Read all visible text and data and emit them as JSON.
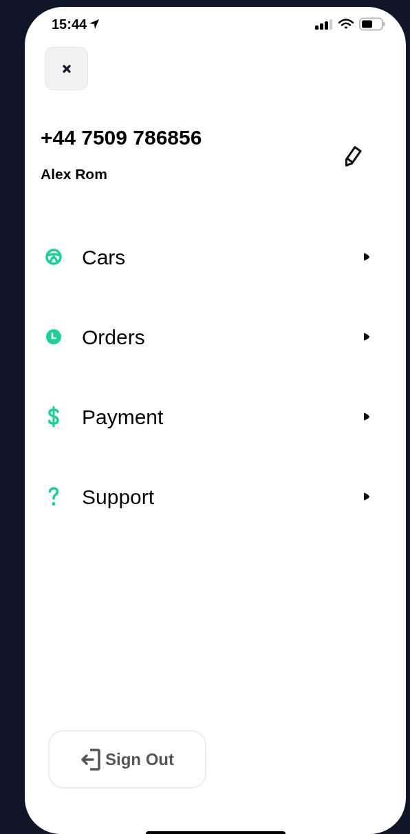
{
  "status_bar": {
    "time": "15:44"
  },
  "profile": {
    "phone": "+44 7509 786856",
    "name": "Alex Rom"
  },
  "menu": [
    {
      "kind": "wheel",
      "label": "Cars"
    },
    {
      "kind": "clock",
      "label": "Orders"
    },
    {
      "kind": "dollar",
      "label": "Payment"
    },
    {
      "kind": "question",
      "label": "Support"
    }
  ],
  "sign_out": {
    "label": "Sign Out"
  }
}
